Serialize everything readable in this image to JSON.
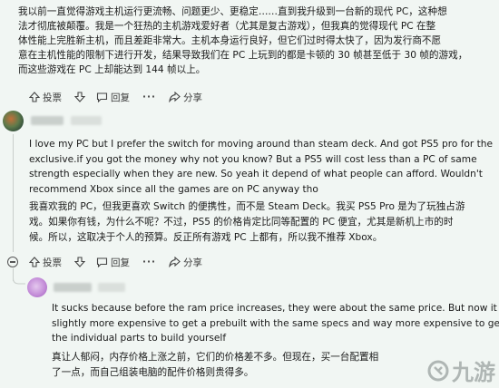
{
  "top_post": {
    "lines": [
      "我以前一直觉得游戏主机运行更流畅、问题更少、更稳定……直到我升级到一台新的现代 PC，这种想",
      "法才彻底被颠覆。我是一个狂热的主机游戏爱好者（尤其是复古游戏），但我真的觉得现代 PC 在整",
      "体性能上完胜新主机，而且差距非常大。主机本身运行良好，但它们过时得太快了，因为发行商不愿",
      "意在主机性能的限制下进行开发，结果导致我们在 PC 上玩到的都是卡顿的 30 帧甚至低于 30 帧的游戏，",
      "而这些游戏在 PC 上却能达到 144 帧以上。"
    ],
    "actions": {
      "vote_label": "投票",
      "reply_label": "回复",
      "share_label": "分享"
    }
  },
  "comment1": {
    "english_lines": [
      "I love my PC but I prefer the switch for moving around than steam deck. And got PS5 pro for the",
      "exclusive.if you got the money why not you know? But a PS5 will cost less than a PC of same",
      "strength especially when they are new. So yeah it depend of what people can afford. Wouldn't",
      "recommend Xbox since all the games are on PC anyway tho"
    ],
    "chinese_lines": [
      "我喜欢我的 PC，但我更喜欢 Switch 的便携性，而不是 Steam Deck。我买 PS5 Pro 是为了玩独占游",
      "戏。如果你有钱，为什么不呢？不过，PS5 的价格肯定比同等配置的 PC 便宜，尤其是新机上市的时",
      "候。所以，这取决于个人的预算。反正所有游戏 PC 上都有，所以我不推荐 Xbox。"
    ],
    "actions": {
      "vote_label": "投票",
      "reply_label": "回复",
      "share_label": "分享"
    }
  },
  "comment2": {
    "english_lines": [
      "It sucks because before the ram price increases, they were about the same price. But now it is",
      "slightly more expensive to get a prebuilt with the same specs and way more expensive to get",
      "the individual parts to build yourself"
    ],
    "chinese_lines": [
      "真让人郁闷，内存价格上涨之前，它们的价格差不多。但现在，买一台配置相",
      "了一点，而自己组装电脑的配件价格则贵得多。"
    ]
  },
  "watermark": {
    "text": "九游"
  },
  "icons": [
    "upvote-icon",
    "downvote-icon",
    "comment-icon",
    "share-icon",
    "more-icon",
    "collapse-icon"
  ]
}
